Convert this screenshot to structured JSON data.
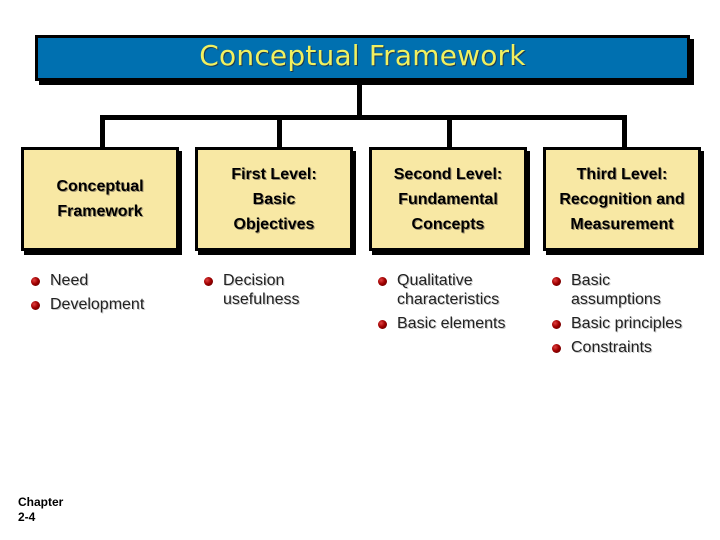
{
  "header": {
    "title": "Conceptual Framework"
  },
  "columns": [
    {
      "label": "Conceptual\nFramework",
      "bullets": [
        "Need",
        "Development"
      ]
    },
    {
      "label": "First Level:\nBasic\nObjectives",
      "bullets": [
        "Decision usefulness"
      ]
    },
    {
      "label": "Second Level:\nFundamental\nConcepts",
      "bullets": [
        "Qualitative characteristics",
        "Basic elements"
      ]
    },
    {
      "label": "Third Level:\nRecognition and\nMeasurement",
      "bullets": [
        "Basic assumptions",
        "Basic principles",
        "Constraints"
      ]
    }
  ],
  "footer": {
    "line1": "Chapter",
    "line2": "2-4"
  },
  "colors": {
    "header_bg": "#0070b0",
    "header_text": "#f0f060",
    "box_bg": "#f8e8a4",
    "bullet": "#a00000"
  }
}
